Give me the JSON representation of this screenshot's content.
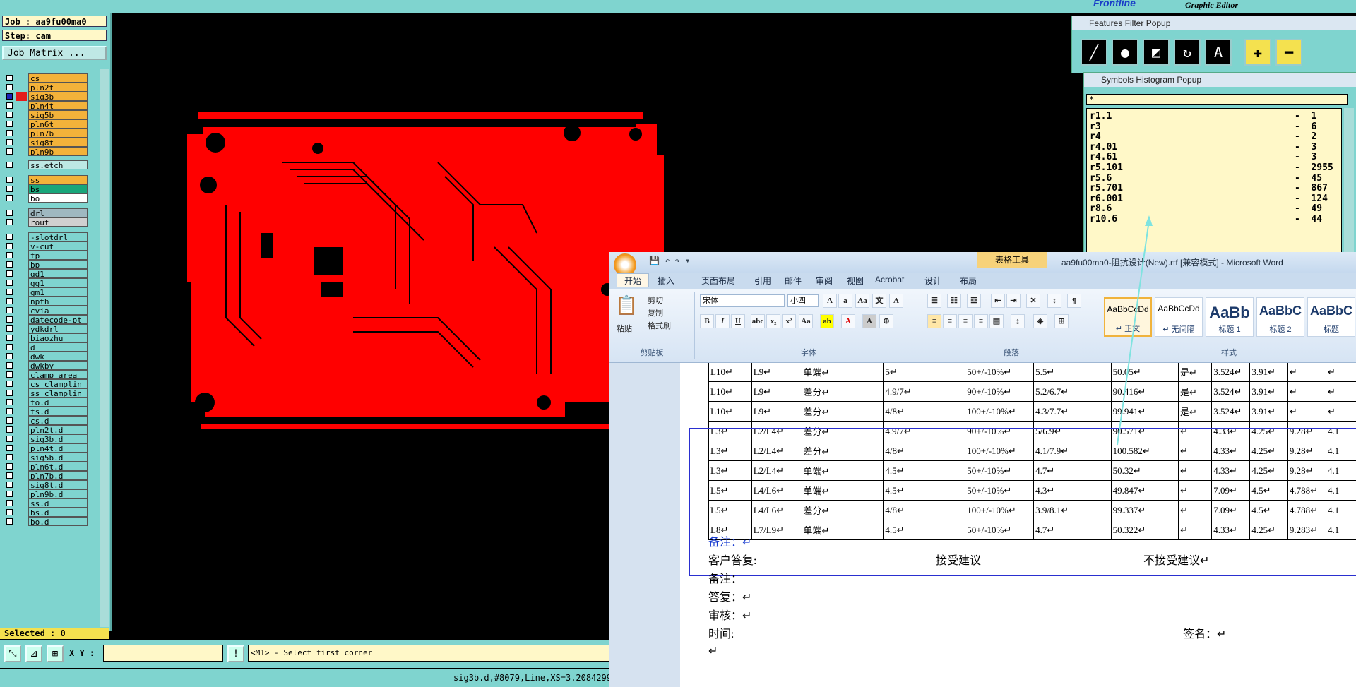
{
  "editor": {
    "job_label": "Job : aa9fu00ma0",
    "step_label": "Step: cam",
    "job_matrix_button": "Job Matrix ...",
    "selected_label": "Selected : 0",
    "xy_label": "X Y :",
    "message": "<M1> - Select first corner",
    "status": "sig3b.d,#8079,Line,XS=3.2084299"
  },
  "brand": {
    "logo": "Frontline",
    "subtitle": "Graphic Editor"
  },
  "layers": [
    {
      "name": "cs",
      "color": "#f3b23a"
    },
    {
      "name": "pln2t",
      "color": "#f3b23a"
    },
    {
      "name": "sig3b",
      "color": "#f3b23a",
      "active": true
    },
    {
      "name": "pln4t",
      "color": "#f3b23a"
    },
    {
      "name": "sig5b",
      "color": "#f3b23a"
    },
    {
      "name": "pln6t",
      "color": "#f3b23a"
    },
    {
      "name": "pln7b",
      "color": "#f3b23a"
    },
    {
      "name": "sig8t",
      "color": "#f3b23a"
    },
    {
      "name": "pln9b",
      "color": "#f3b23a"
    },
    {
      "name": "ss.etch",
      "color": "#bde8e4"
    },
    {
      "name": "ss",
      "color": "#f3b23a"
    },
    {
      "name": "bs",
      "color": "#19a67a"
    },
    {
      "name": "bo",
      "color": "#ffffff"
    },
    {
      "name": "drl",
      "color": "#9fb8c0"
    },
    {
      "name": "rout",
      "color": "#d0d0d0"
    },
    {
      "name": "-slotdrl",
      "color": "#7fd4cf"
    },
    {
      "name": "v-cut",
      "color": "#7fd4cf"
    },
    {
      "name": "tp",
      "color": "#7fd4cf"
    },
    {
      "name": "bp",
      "color": "#7fd4cf"
    },
    {
      "name": "gd1",
      "color": "#7fd4cf"
    },
    {
      "name": "gg1",
      "color": "#7fd4cf"
    },
    {
      "name": "gm1",
      "color": "#7fd4cf"
    },
    {
      "name": "npth",
      "color": "#7fd4cf"
    },
    {
      "name": "cvia",
      "color": "#7fd4cf"
    },
    {
      "name": "datecode-pt",
      "color": "#7fd4cf"
    },
    {
      "name": "ydkdrl",
      "color": "#7fd4cf"
    },
    {
      "name": "biaozhu",
      "color": "#7fd4cf"
    },
    {
      "name": "d",
      "color": "#7fd4cf"
    },
    {
      "name": "dwk",
      "color": "#7fd4cf"
    },
    {
      "name": "dwkby",
      "color": "#7fd4cf"
    },
    {
      "name": "clamp_area",
      "color": "#7fd4cf"
    },
    {
      "name": "cs_clamplin",
      "color": "#7fd4cf"
    },
    {
      "name": "ss_clamplin",
      "color": "#7fd4cf"
    },
    {
      "name": "to.d",
      "color": "#7fd4cf"
    },
    {
      "name": "ts.d",
      "color": "#7fd4cf"
    },
    {
      "name": "cs.d",
      "color": "#7fd4cf"
    },
    {
      "name": "pln2t.d",
      "color": "#7fd4cf"
    },
    {
      "name": "sig3b.d",
      "color": "#7fd4cf"
    },
    {
      "name": "pln4t.d",
      "color": "#7fd4cf"
    },
    {
      "name": "sig5b.d",
      "color": "#7fd4cf"
    },
    {
      "name": "pln6t.d",
      "color": "#7fd4cf"
    },
    {
      "name": "pln7b.d",
      "color": "#7fd4cf"
    },
    {
      "name": "sig8t.d",
      "color": "#7fd4cf"
    },
    {
      "name": "pln9b.d",
      "color": "#7fd4cf"
    },
    {
      "name": "ss.d",
      "color": "#7fd4cf"
    },
    {
      "name": "bs.d",
      "color": "#7fd4cf"
    },
    {
      "name": "bo.d",
      "color": "#7fd4cf"
    }
  ],
  "features_filter": {
    "title": "Features Filter Popup"
  },
  "histogram": {
    "title": "Symbols Histogram Popup",
    "filter": "*",
    "rows": [
      {
        "symbol": "r1.1",
        "count": "-  1"
      },
      {
        "symbol": "r3",
        "count": "-  6"
      },
      {
        "symbol": "r4",
        "count": "-  2"
      },
      {
        "symbol": "r4.01",
        "count": "-  3"
      },
      {
        "symbol": "r4.61",
        "count": "-  3"
      },
      {
        "symbol": "r5.101",
        "count": "-  2955"
      },
      {
        "symbol": "r5.6",
        "count": "-  45"
      },
      {
        "symbol": "r5.701",
        "count": "-  867"
      },
      {
        "symbol": "r6.001",
        "count": "-  124"
      },
      {
        "symbol": "r8.6",
        "count": "-  49"
      },
      {
        "symbol": "r10.6",
        "count": "-  44"
      }
    ]
  },
  "word": {
    "title": "aa9fu00ma0-阻抗设计(New).rtf [兼容模式] - Microsoft Word",
    "context_tab": "表格工具",
    "tabs": [
      "开始",
      "插入",
      "页面布局",
      "引用",
      "邮件",
      "审阅",
      "视图",
      "Acrobat",
      "设计",
      "布局"
    ],
    "clipboard": {
      "paste": "粘贴",
      "cut": "剪切",
      "copy": "复制",
      "format_painter": "格式刷",
      "label": "剪贴板"
    },
    "font": {
      "name": "宋体",
      "size": "小四",
      "label": "字体"
    },
    "paragraph_label": "段落",
    "styles_label": "样式",
    "styles": [
      {
        "sample": "AaBbCcDd",
        "name": "↵ 正文"
      },
      {
        "sample": "AaBbCcDd",
        "name": "↵ 无间隔"
      },
      {
        "sample": "AaBb",
        "name": "标题 1"
      },
      {
        "sample": "AaBbC",
        "name": "标题 2"
      },
      {
        "sample": "AaBbC",
        "name": "标题"
      }
    ],
    "table_rows": [
      [
        "L10↵",
        "L9↵",
        "单端↵",
        "5↵",
        "50+/-10%↵",
        "5.5↵",
        "50.05↵",
        "是↵",
        "3.524↵",
        "3.91↵",
        "↵",
        "↵"
      ],
      [
        "L10↵",
        "L9↵",
        "差分↵",
        "4.9/7↵",
        "90+/-10%↵",
        "5.2/6.7↵",
        "90.416↵",
        "是↵",
        "3.524↵",
        "3.91↵",
        "↵",
        "↵"
      ],
      [
        "L10↵",
        "L9↵",
        "差分↵",
        "4/8↵",
        "100+/-10%↵",
        "4.3/7.7↵",
        "99.941↵",
        "是↵",
        "3.524↵",
        "3.91↵",
        "↵",
        "↵"
      ],
      [
        "L3↵",
        "L2/L4↵",
        "差分↵",
        "4.9/7↵",
        "90+/-10%↵",
        "5/6.9↵",
        "90.571↵",
        "↵",
        "4.33↵",
        "4.25↵",
        "9.28↵",
        "4.1"
      ],
      [
        "L3↵",
        "L2/L4↵",
        "差分↵",
        "4/8↵",
        "100+/-10%↵",
        "4.1/7.9↵",
        "100.582↵",
        "↵",
        "4.33↵",
        "4.25↵",
        "9.28↵",
        "4.1"
      ],
      [
        "L3↵",
        "L2/L4↵",
        "单端↵",
        "4.5↵",
        "50+/-10%↵",
        "4.7↵",
        "50.32↵",
        "↵",
        "4.33↵",
        "4.25↵",
        "9.28↵",
        "4.1"
      ],
      [
        "L5↵",
        "L4/L6↵",
        "单端↵",
        "4.5↵",
        "50+/-10%↵",
        "4.3↵",
        "49.847↵",
        "↵",
        "7.09↵",
        "4.5↵",
        "4.788↵",
        "4.1"
      ],
      [
        "L5↵",
        "L4/L6↵",
        "差分↵",
        "4/8↵",
        "100+/-10%↵",
        "3.9/8.1↵",
        "99.337↵",
        "↵",
        "7.09↵",
        "4.5↵",
        "4.788↵",
        "4.1"
      ],
      [
        "L8↵",
        "L7/L9↵",
        "单端↵",
        "4.5↵",
        "50+/-10%↵",
        "4.7↵",
        "50.322↵",
        "↵",
        "4.33↵",
        "4.25↵",
        "9.283↵",
        "4.1"
      ]
    ],
    "notes": {
      "note1": "备注：↵",
      "customer_reply": "客户答复:",
      "accept": "接受建议",
      "reject": "不接受建议↵",
      "note2": "备注：",
      "reply": "答复：↵",
      "review": "审核：↵",
      "time": "时间:",
      "sign": "签名：↵",
      "last": "↵"
    }
  }
}
